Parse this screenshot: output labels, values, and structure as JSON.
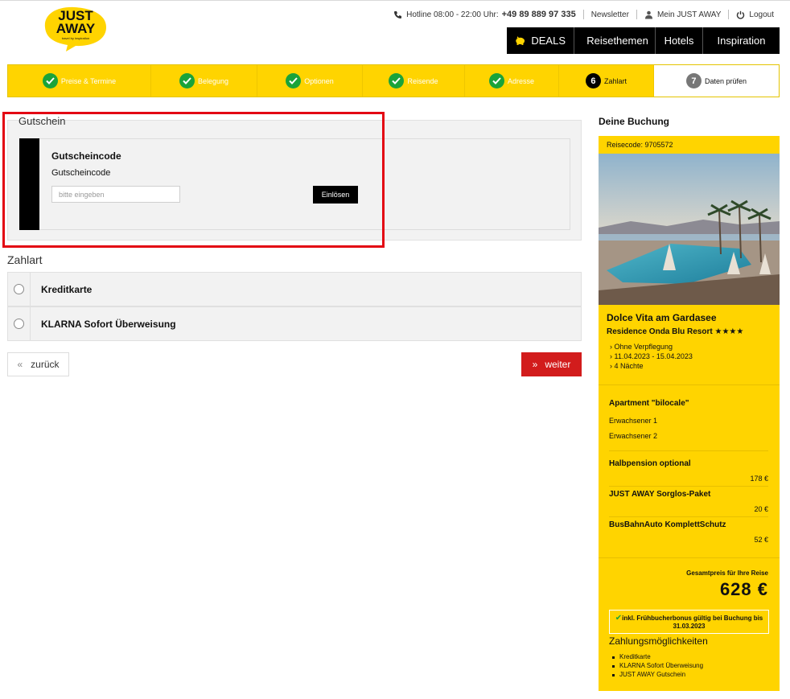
{
  "brand": {
    "logo_line1": "JUST",
    "logo_line2": "AWAY",
    "logo_tagline": "travel by inspiration"
  },
  "topbar": {
    "hotline_label": "Hotline 08:00 - 22:00 Uhr:",
    "hotline_number": "+49 89 889 97 335",
    "newsletter": "Newsletter",
    "account": "Mein JUST AWAY",
    "logout": "Logout"
  },
  "mainnav": [
    {
      "label": "DEALS",
      "icon": "piggy-icon"
    },
    {
      "label": "Reisethemen",
      "icon": "heart-icon"
    },
    {
      "label": "Hotels"
    },
    {
      "label": "Inspiration"
    }
  ],
  "steps": [
    {
      "label": "Preise & Termine",
      "state": "done"
    },
    {
      "label": "Belegung",
      "state": "done"
    },
    {
      "label": "Optionen",
      "state": "done"
    },
    {
      "label": "Reisende",
      "state": "done"
    },
    {
      "label": "Adresse",
      "state": "done"
    },
    {
      "label": "Zahlart",
      "num": "6",
      "state": "current"
    },
    {
      "label": "Daten prüfen",
      "num": "7",
      "state": "todo"
    }
  ],
  "voucher": {
    "section_title": "Gutschein",
    "heading": "Gutscheincode",
    "label": "Gutscheincode",
    "placeholder": "bitte eingeben",
    "value": "",
    "button": "Einlösen"
  },
  "payment": {
    "title": "Zahlart",
    "options": [
      "Kreditkarte",
      "KLARNA Sofort Überweisung"
    ]
  },
  "nav_buttons": {
    "back": "zurück",
    "next": "weiter"
  },
  "booking": {
    "title": "Deine Buchung",
    "code": "Reisecode: 9705572",
    "trip_name": "Dolce Vita am Gardasee",
    "hotel": "Residence Onda Blu Resort ★★★★",
    "details": [
      "Ohne Verpflegung",
      "11.04.2023 - 15.04.2023",
      "4 Nächte"
    ],
    "room": "Apartment \"bilocale\"",
    "travellers": [
      "Erwachsener 1",
      "Erwachsener 2"
    ],
    "extras": [
      {
        "name": "Halbpension optional",
        "price": "178 €"
      },
      {
        "name": "JUST AWAY Sorglos-Paket",
        "price": "20 €"
      },
      {
        "name": "BusBahnAuto KomplettSchutz",
        "price": "52 €"
      }
    ],
    "total_label": "Gesamtpreis für Ihre Reise",
    "total": "628 €",
    "bonus": "inkl. Frühbucherbonus gültig bei Buchung bis 31.03.2023",
    "payment_methods_title": "Zahlungsmöglichkeiten",
    "payment_methods": [
      "Kreditkarte",
      "KLARNA Sofort Überweisung",
      "JUST AWAY Gutschein"
    ]
  },
  "colors": {
    "brand_yellow": "#ffd400",
    "accent_red": "#d21c1c",
    "check_green": "#1aa33a",
    "highlight_red": "#e30613"
  }
}
